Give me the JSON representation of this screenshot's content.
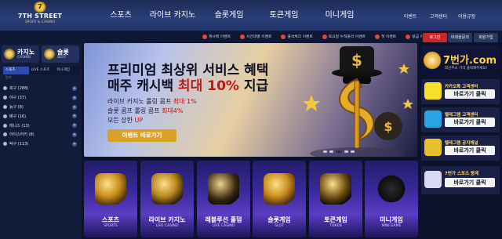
{
  "header": {
    "logo_line1": "7TH STREET",
    "logo_line2": "SPORT & CASINO",
    "main_nav": [
      "스포츠",
      "라이브 카지노",
      "슬롯게임",
      "토큰게임",
      "미니게임"
    ],
    "sub_nav": [
      "이벤트",
      "고객센터",
      "이용규정"
    ]
  },
  "secondary_bar": {
    "items": [
      "캐시백 이벤트",
      "시간대별 이벤트",
      "출석체크 이벤트",
      "토요일 누적출석 이벤트",
      "첫 이벤트",
      "방금 이벤트"
    ],
    "login": "로그인",
    "find": "비회원문의",
    "join": "회원가입"
  },
  "sidebar": {
    "cat_casino": {
      "name": "카지노",
      "sub": "CASINO"
    },
    "cat_slot": {
      "name": "슬롯",
      "sub": "SLOT"
    },
    "tabs": [
      "스포츠",
      "LIVE 스포츠",
      "미니게임"
    ],
    "tabs2": [
      "인기",
      "",
      ""
    ],
    "sports": [
      {
        "name": "축구 (288)"
      },
      {
        "name": "야구 (37)"
      },
      {
        "name": "농구 (8)"
      },
      {
        "name": "배구 (16)"
      },
      {
        "name": "테니스 (13)"
      },
      {
        "name": "아이스하키 (8)"
      },
      {
        "name": "탁구 (113)"
      }
    ]
  },
  "banner": {
    "line1": "프리미엄 최상위 서비스 혜택",
    "line2a": "매주 캐시백 ",
    "line2b": "최대 10%",
    "line2c": " 지급",
    "l1a": "라이브 카지노 롤링 콤프 ",
    "l1b": "최대 1%",
    "l2a": "슬롯 콤프 롤링 콤프 ",
    "l2b": "최대4%",
    "l3a": "모든 상한 ",
    "l3b": "UP",
    "cta": "이벤트 바로가기",
    "slides": 5,
    "active_slide": 2
  },
  "tiles": [
    {
      "name": "스포츠",
      "sub": "SPORTS"
    },
    {
      "name": "라이브 카지노",
      "sub": "LIVE CASINO"
    },
    {
      "name": "레볼루션 홀덤",
      "sub": "LIVE CASINO"
    },
    {
      "name": "슬롯게임",
      "sub": "SLOT"
    },
    {
      "name": "토큰게임",
      "sub": "TOKEN"
    },
    {
      "name": "미니게임",
      "sub": "MINI GAME"
    }
  ],
  "right": {
    "promo_big": "7번가.com",
    "promo_small": "최신주소 기억 클릭해주세요!",
    "boxes": [
      {
        "title": "카카오톡 고객센터",
        "action": "바로가기 클릭",
        "color": "#f7e02a"
      },
      {
        "title": "텔레그램 고객센터",
        "action": "바로가기 클릭",
        "color": "#2aa3e2"
      },
      {
        "title": "텔레그램 공지채널",
        "action": "바로가기 클릭",
        "color": "#e8c02d"
      },
      {
        "title": "7번가 스포츠 중계",
        "action": "바로가기 클릭",
        "color": "#d9d9f2"
      }
    ]
  }
}
